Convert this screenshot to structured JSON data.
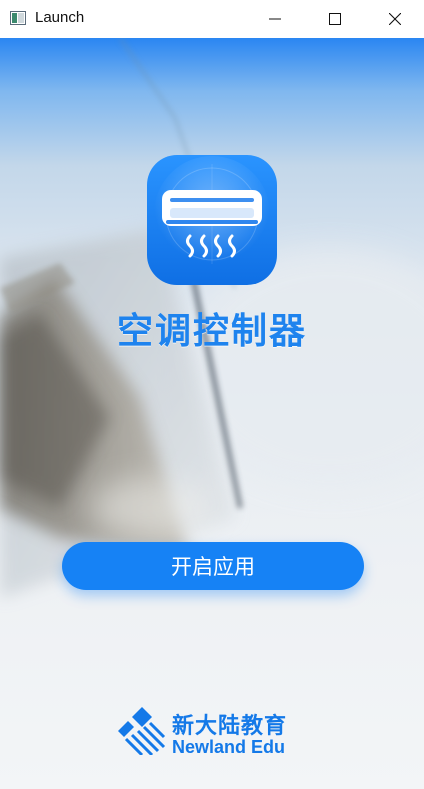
{
  "window": {
    "title": "Launch",
    "icons": {
      "app": "window-app-icon",
      "minimize": "minimize-icon",
      "maximize": "maximize-icon",
      "close": "close-icon"
    }
  },
  "splash": {
    "logo_icon": "air-conditioner-icon",
    "app_title": "空调控制器",
    "start_button": "开启应用"
  },
  "brand": {
    "mark_icon": "newland-logo-icon",
    "name_cn": "新大陆教育",
    "name_en": "Newland Edu"
  },
  "colors": {
    "accent": "#1682f5",
    "title": "#1e83ee",
    "brand": "#1479e8"
  }
}
